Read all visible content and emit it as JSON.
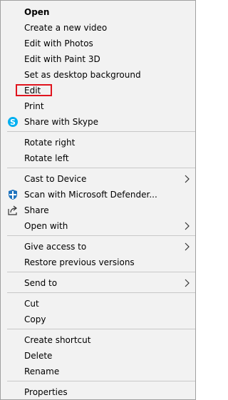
{
  "menu": {
    "items": {
      "open": "Open",
      "create_video": "Create a new video",
      "edit_photos": "Edit with Photos",
      "edit_paint3d": "Edit with Paint 3D",
      "set_desktop_bg": "Set as desktop background",
      "edit": "Edit",
      "print": "Print",
      "share_skype": "Share with Skype",
      "rotate_right": "Rotate right",
      "rotate_left": "Rotate left",
      "cast_device": "Cast to Device",
      "scan_defender": "Scan with Microsoft Defender...",
      "share": "Share",
      "open_with": "Open with",
      "give_access": "Give access to",
      "restore_versions": "Restore previous versions",
      "send_to": "Send to",
      "cut": "Cut",
      "copy": "Copy",
      "create_shortcut": "Create shortcut",
      "delete": "Delete",
      "rename": "Rename",
      "properties": "Properties"
    },
    "icons": {
      "share_skype": "skype-icon",
      "scan_defender": "defender-shield-icon",
      "share": "share-icon",
      "submenu": "chevron-right-icon"
    },
    "colors": {
      "background": "#f2f2f2",
      "highlight_box": "#e0141e",
      "skype": "#00aff0",
      "defender": "#1e73be"
    }
  }
}
